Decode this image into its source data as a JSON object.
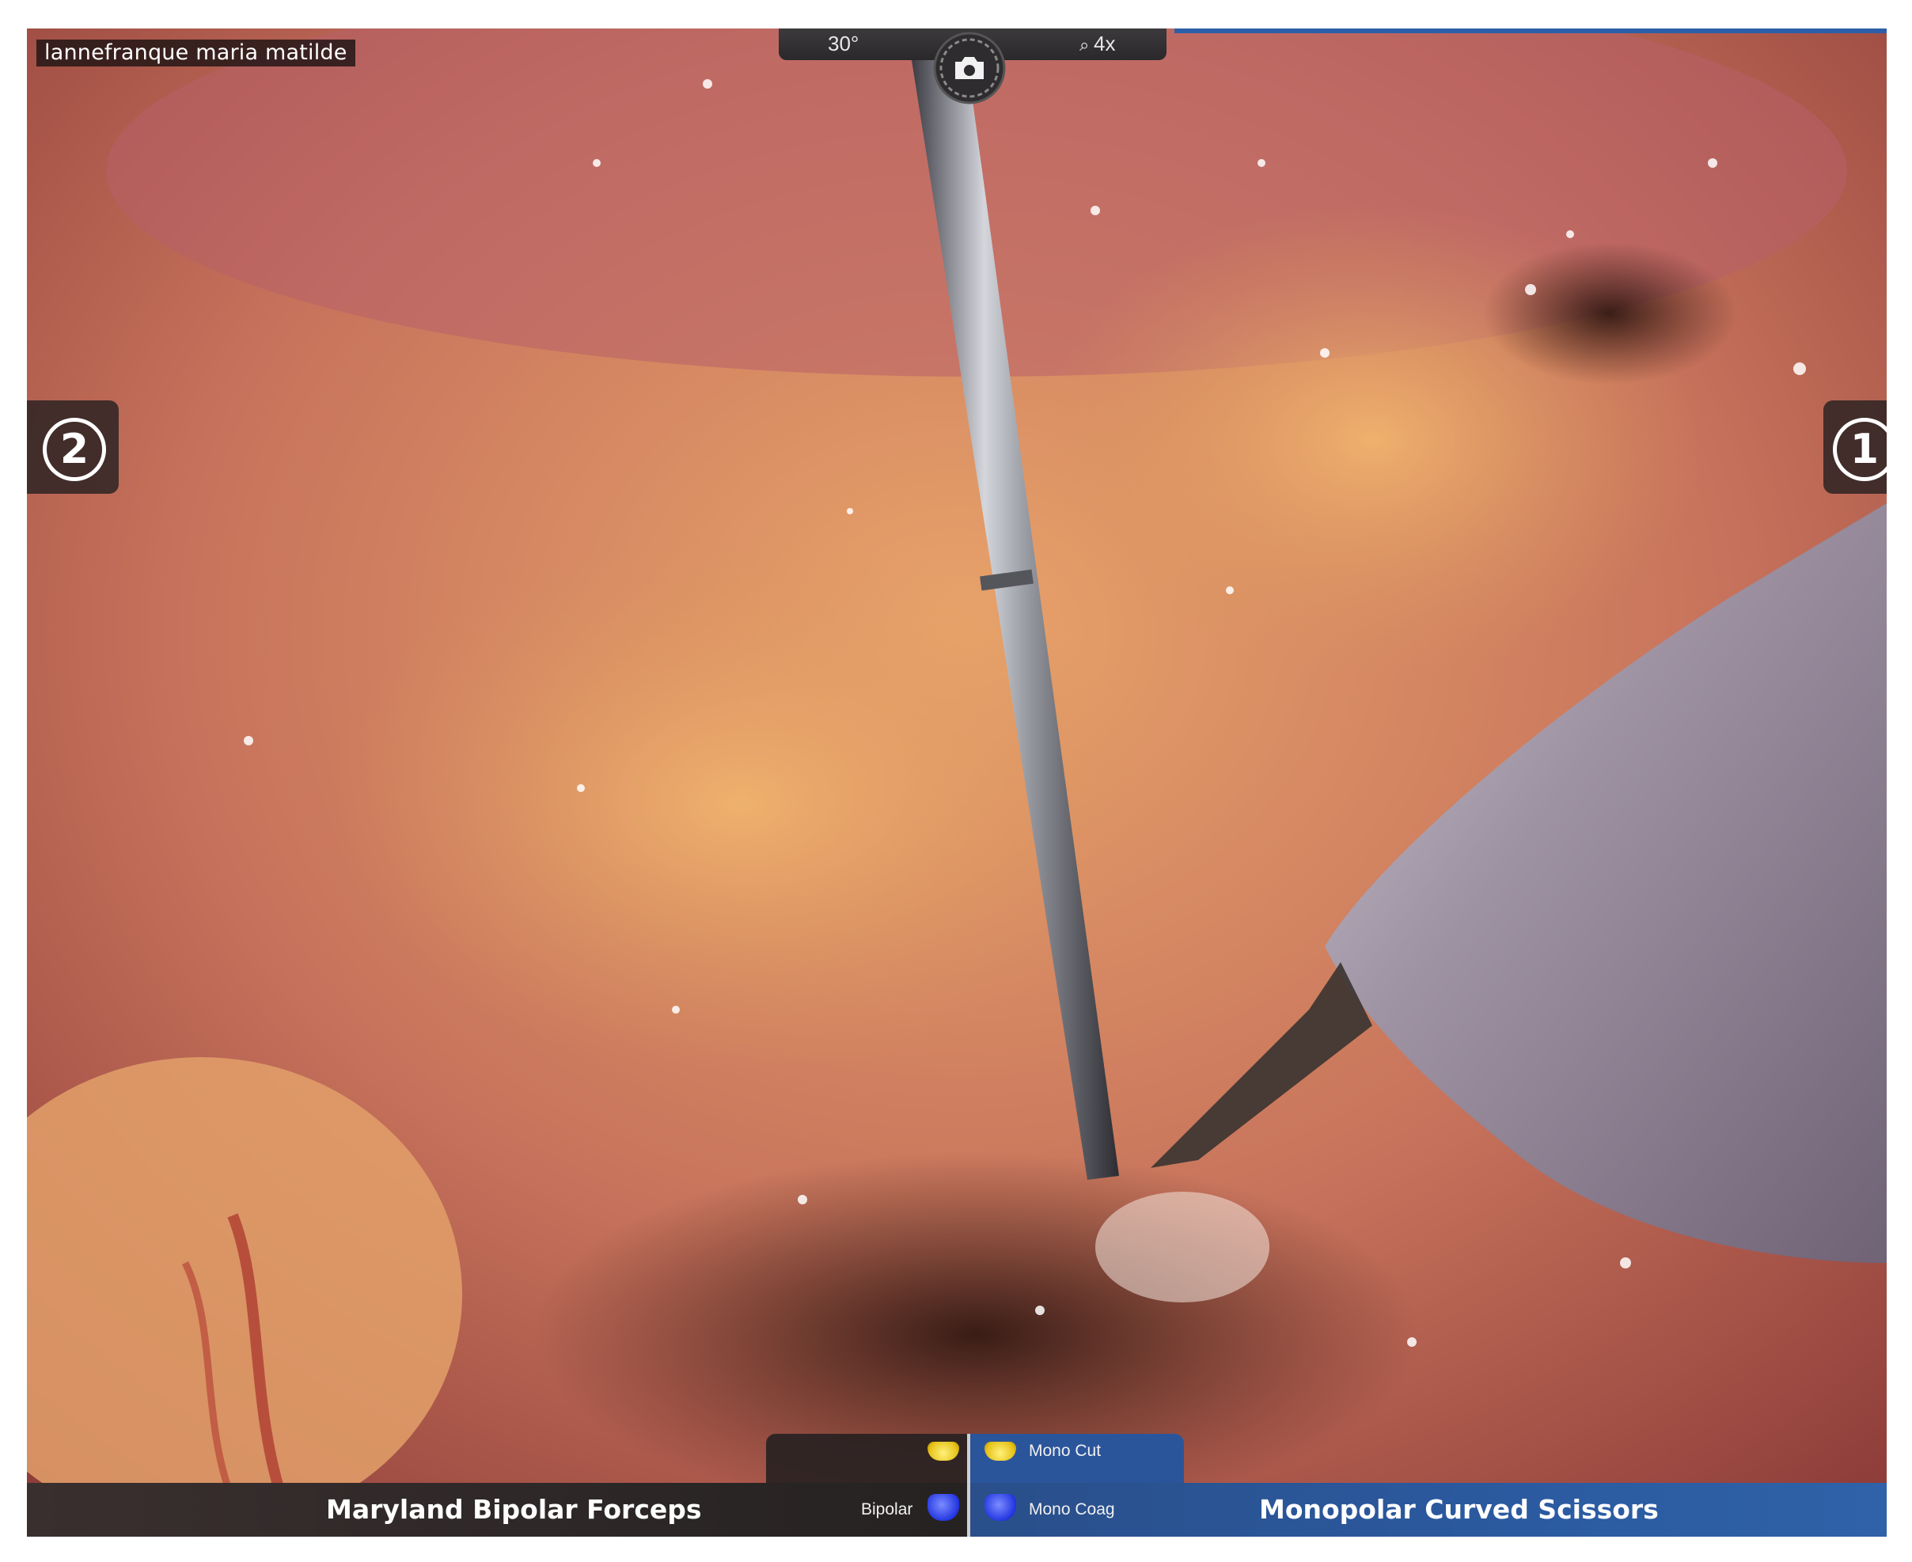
{
  "overlay": {
    "patient_name": "lannefranque maria matilde",
    "scope_angle": "30°",
    "zoom_level": "4x"
  },
  "arms": {
    "left_number": "2",
    "right_number": "1"
  },
  "instruments": {
    "left_name": "Maryland Bipolar Forceps",
    "right_name": "Monopolar Curved Scissors"
  },
  "pedals": {
    "bipolar_label": "Bipolar",
    "mono_cut_label": "Mono Cut",
    "mono_coag_label": "Mono Coag"
  },
  "colors": {
    "right_bar": "#2b5aa0",
    "left_bar": "#2d2727",
    "pedal_yellow": "#e6c21a",
    "pedal_blue": "#2335e0"
  },
  "icons": {
    "camera": "camera-engaged-icon",
    "zoom": "magnifier-icon",
    "scope_angle": "scope-angle-down-icon"
  }
}
